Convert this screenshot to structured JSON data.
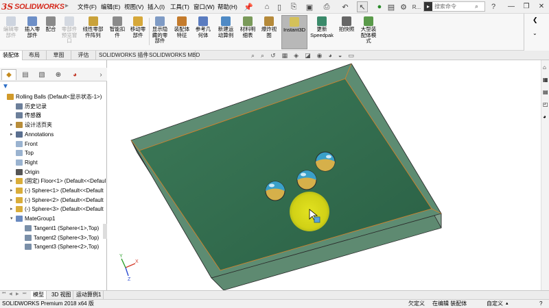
{
  "app": {
    "logo_ds": "3S",
    "logo_name": "SOLIDWORKS",
    "separator": "▸"
  },
  "menu": [
    {
      "label": "文件(F)"
    },
    {
      "label": "编辑(E)"
    },
    {
      "label": "视图(V)"
    },
    {
      "label": "插入(I)"
    },
    {
      "label": "工具(T)"
    },
    {
      "label": "窗口(W)"
    },
    {
      "label": "帮助(H)"
    }
  ],
  "search": {
    "placeholder": "搜索命令",
    "value": "搜索命令"
  },
  "quick_access_trailing": "R...",
  "commands": [
    {
      "label": "编辑零\n部件",
      "icon": "edit-component-icon",
      "disabled": true,
      "color": "#9aa9c0"
    },
    {
      "label": "插入零\n部件",
      "icon": "insert-component-icon",
      "disabled": false,
      "color": "#6d8fc7"
    },
    {
      "label": "配合",
      "icon": "mate-icon",
      "disabled": false,
      "color": "#8a8a8a"
    },
    {
      "label": "零部件\n预览窗\n口",
      "icon": "component-preview-icon",
      "disabled": true,
      "color": "#a8b4c6"
    },
    {
      "label": "线性零部\n件阵列",
      "icon": "linear-pattern-icon",
      "disabled": false,
      "color": "#c9a23a"
    },
    {
      "label": "智能扣\n件",
      "icon": "smart-fastener-icon",
      "disabled": false,
      "color": "#8b8b8b"
    },
    {
      "label": "移动零\n部件",
      "icon": "move-component-icon",
      "disabled": false,
      "color": "#d6a83a"
    },
    {
      "label": "显示隐\n藏的零\n部件",
      "icon": "show-hidden-icon",
      "disabled": false,
      "color": "#7f9bc5"
    },
    {
      "label": "装配体\n特征",
      "icon": "assembly-feature-icon",
      "disabled": false,
      "color": "#c47b2c"
    },
    {
      "label": "参考几\n何体",
      "icon": "reference-geometry-icon",
      "disabled": false,
      "color": "#5a7cc0"
    },
    {
      "label": "新建运\n动算例",
      "icon": "new-motion-study-icon",
      "disabled": false,
      "color": "#4f8ac5"
    },
    {
      "label": "材料明\n细表",
      "icon": "bom-icon",
      "disabled": false,
      "color": "#7a9a5a"
    },
    {
      "label": "爆炸视\n图",
      "icon": "exploded-view-icon",
      "disabled": false,
      "color": "#b58a3a"
    },
    {
      "label": "Instant3D",
      "icon": "instant3d-icon",
      "disabled": false,
      "color": "#d4c15a"
    },
    {
      "label": "更新\nSpeedpak",
      "icon": "speedpak-icon",
      "disabled": false,
      "color": "#3a8a6a"
    },
    {
      "label": "拍快照",
      "icon": "snapshot-icon",
      "disabled": false,
      "color": "#666666"
    },
    {
      "label": "大型装\n配体模\n式",
      "icon": "large-assembly-icon",
      "disabled": false,
      "color": "#5a9a4a"
    }
  ],
  "tabs": [
    {
      "label": "装配体"
    },
    {
      "label": "布局"
    },
    {
      "label": "草图"
    },
    {
      "label": "评估"
    },
    {
      "label": "SOLIDWORKS 插件"
    },
    {
      "label": "SOLIDWORKS MBD"
    }
  ],
  "tree": [
    {
      "label": "Rolling Balls  (Default<显示状态-1>)",
      "icon": "assembly-icon",
      "indent": 0,
      "expander": ""
    },
    {
      "label": "历史记录",
      "icon": "history-icon",
      "indent": 1,
      "expander": ""
    },
    {
      "label": "传感器",
      "icon": "sensor-icon",
      "indent": 1,
      "expander": ""
    },
    {
      "label": "设计活页夹",
      "icon": "design-binder-icon",
      "indent": 1,
      "expander": "▸"
    },
    {
      "label": "Annotations",
      "icon": "annotations-icon",
      "indent": 1,
      "expander": "▸"
    },
    {
      "label": "Front",
      "icon": "plane-icon",
      "indent": 1,
      "expander": ""
    },
    {
      "label": "Top",
      "icon": "plane-icon",
      "indent": 1,
      "expander": ""
    },
    {
      "label": "Right",
      "icon": "plane-icon",
      "indent": 1,
      "expander": ""
    },
    {
      "label": "Origin",
      "icon": "origin-icon",
      "indent": 1,
      "expander": ""
    },
    {
      "label": "(固定) Floor<1> (Default<<Defaul",
      "icon": "part-icon",
      "indent": 1,
      "expander": "▸"
    },
    {
      "label": "(-) Sphere<1> (Default<<Default",
      "icon": "part-icon",
      "indent": 1,
      "expander": "▸"
    },
    {
      "label": "(-) Sphere<2> (Default<<Default",
      "icon": "part-icon",
      "indent": 1,
      "expander": "▸"
    },
    {
      "label": "(-) Sphere<3> (Default<<Default",
      "icon": "part-icon",
      "indent": 1,
      "expander": "▸"
    },
    {
      "label": "MateGroup1",
      "icon": "mate-group-icon",
      "indent": 1,
      "expander": "▾"
    },
    {
      "label": "Tangent1 (Sphere<1>,Top)",
      "icon": "tangent-mate-icon",
      "indent": 2,
      "expander": ""
    },
    {
      "label": "Tangent2 (Sphere<3>,Top)",
      "icon": "tangent-mate-icon",
      "indent": 2,
      "expander": ""
    },
    {
      "label": "Tangent3 (Sphere<2>,Top)",
      "icon": "tangent-mate-icon",
      "indent": 2,
      "expander": ""
    }
  ],
  "bottom_tabs": [
    {
      "label": "模型"
    },
    {
      "label": "3D 视图"
    },
    {
      "label": "运动算例1"
    }
  ],
  "status": {
    "product": "SOLIDWORKS Premium 2018 x64 版",
    "state": "欠定义",
    "mode": "在编辑 装配体",
    "units": "自定义",
    "help": "?"
  },
  "colors": {
    "plate_top": "#2f6a4c",
    "plate_side": "#4c7d62",
    "edge_orange": "#d5822a",
    "highlight": "#d7d615"
  },
  "axis_labels": {
    "x": "X",
    "y": "Y",
    "z": "Z"
  }
}
